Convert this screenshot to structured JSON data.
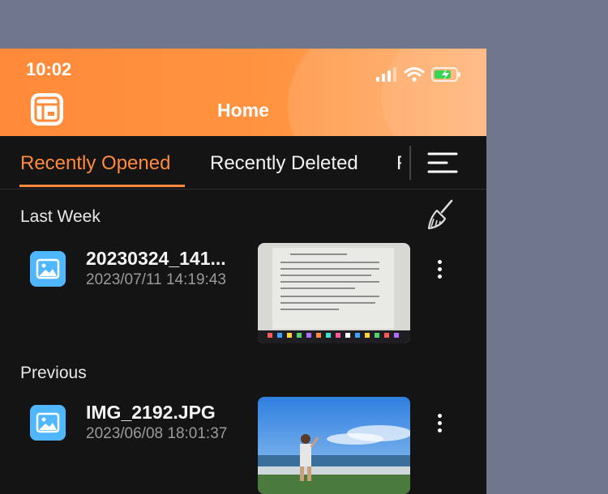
{
  "status_bar": {
    "time": "10:02"
  },
  "header": {
    "title": "Home"
  },
  "tabs": [
    {
      "label": "Recently Opened",
      "active": true
    },
    {
      "label": "Recently Deleted",
      "active": false
    }
  ],
  "sections": [
    {
      "title": "Last Week",
      "items": [
        {
          "name": "20230324_141...",
          "date": "2023/07/11 14:19:43"
        }
      ]
    },
    {
      "title": "Previous",
      "items": [
        {
          "name": "IMG_2192.JPG",
          "date": "2023/06/08 18:01:37"
        }
      ]
    }
  ],
  "colors": {
    "accent": "#ff8a3d",
    "background": "#141414",
    "icon_blue": "#4fb7ff"
  }
}
